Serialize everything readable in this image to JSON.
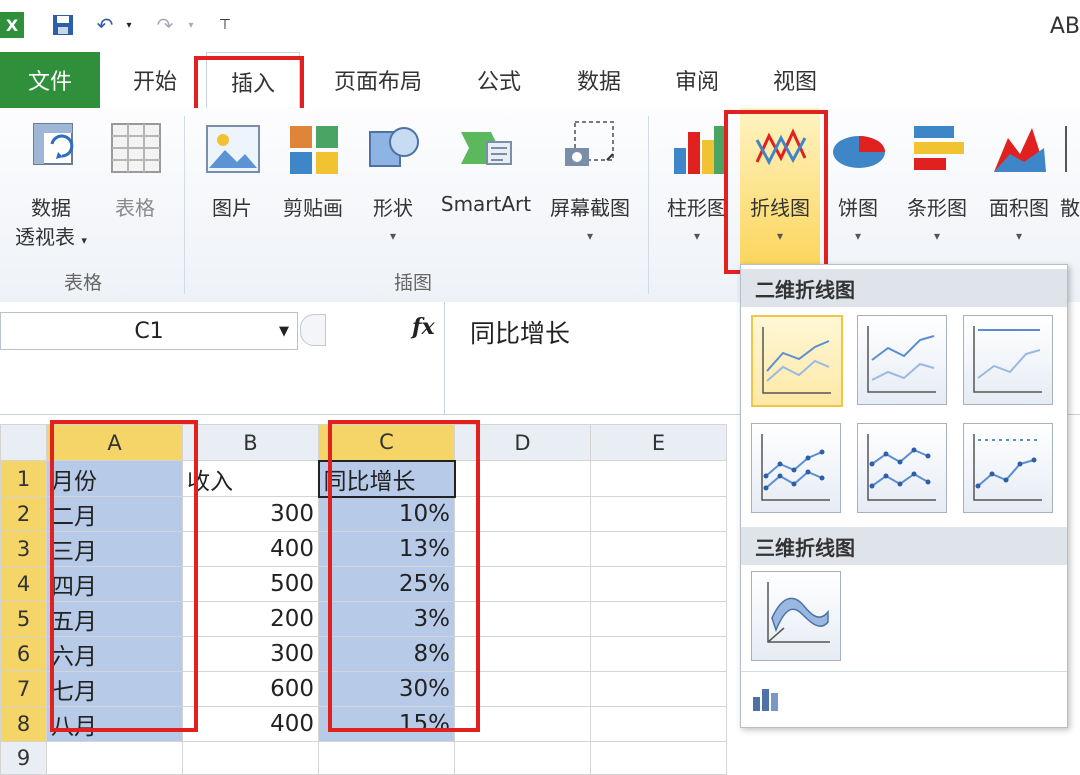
{
  "app": {
    "title": "AB"
  },
  "colors": {
    "accent_red": "#e0211f",
    "file_tab": "#2f8f3a",
    "selection": "#b7cbe8",
    "header_selected": "#f5d568"
  },
  "tabs": [
    {
      "label": "文件"
    },
    {
      "label": "开始"
    },
    {
      "label": "插入"
    },
    {
      "label": "页面布局"
    },
    {
      "label": "公式"
    },
    {
      "label": "数据"
    },
    {
      "label": "审阅"
    },
    {
      "label": "视图"
    }
  ],
  "ribbon": {
    "pivot_line1": "数据",
    "pivot_line2": "透视表",
    "table": "表格",
    "group_tables": "表格",
    "picture": "图片",
    "clipart": "剪贴画",
    "shapes": "形状",
    "smartart": "SmartArt",
    "screenshot": "屏幕截图",
    "group_illustrations": "插图",
    "column_chart": "柱形图",
    "line_chart": "折线图",
    "pie_chart": "饼图",
    "bar_chart": "条形图",
    "area_chart": "面积图",
    "scatter_chart": "散"
  },
  "formula_bar": {
    "name_box": "C1",
    "fx": "fx",
    "content": "同比增长"
  },
  "sheet": {
    "columns": [
      "A",
      "B",
      "C",
      "D",
      "E"
    ],
    "rows": [
      {
        "n": "1",
        "a": "月份",
        "b": "收入",
        "c": "同比增长"
      },
      {
        "n": "2",
        "a": "二月",
        "b": "300",
        "c": "10%"
      },
      {
        "n": "3",
        "a": "三月",
        "b": "400",
        "c": "13%"
      },
      {
        "n": "4",
        "a": "四月",
        "b": "500",
        "c": "25%"
      },
      {
        "n": "5",
        "a": "五月",
        "b": "200",
        "c": "3%"
      },
      {
        "n": "6",
        "a": "六月",
        "b": "300",
        "c": "8%"
      },
      {
        "n": "7",
        "a": "七月",
        "b": "600",
        "c": "30%"
      },
      {
        "n": "8",
        "a": "八月",
        "b": "400",
        "c": "15%"
      },
      {
        "n": "9",
        "a": "",
        "b": "",
        "c": ""
      }
    ]
  },
  "dropdown": {
    "section_2d": "二维折线图",
    "section_3d": "三维折线图"
  }
}
